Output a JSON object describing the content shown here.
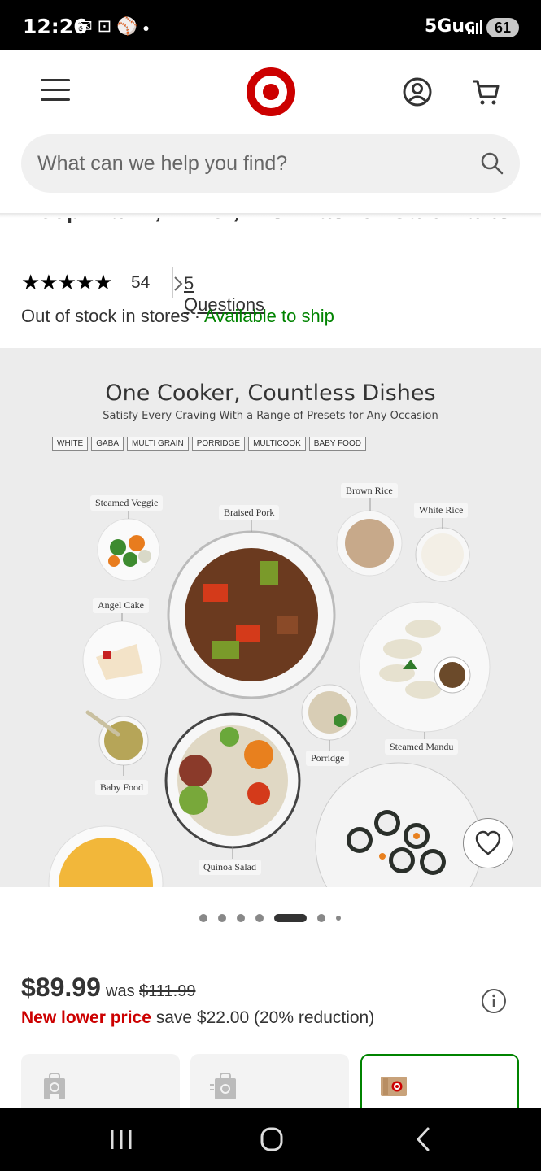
{
  "status_bar": {
    "time": "12:26",
    "notification_icons": [
      "mail-icon",
      "screenshot-icon",
      "sports-ball-icon",
      "dot-icon"
    ],
    "network": "5Guc",
    "battery": "61"
  },
  "header": {
    "brand": "Target",
    "search_placeholder": "What can we help you find?"
  },
  "product": {
    "title": "Keep Warm, Timer, Dishwasher-Safe Parts",
    "rating": "5",
    "review_count": "54",
    "questions": "5 Questions",
    "stock_status": "Out of stock in stores",
    "separator": "·",
    "ship_status": "Available to ship"
  },
  "image": {
    "headline": "One Cooker, Countless Dishes",
    "subheadline": "Satisfy Every Craving With a Range of Presets for Any Occasion",
    "presets": [
      "WHITE",
      "GABA",
      "MULTI GRAIN",
      "PORRIDGE",
      "MULTICOOK",
      "BABY FOOD"
    ],
    "dishes": {
      "steamed_veggie": "Steamed Veggie",
      "braised_pork": "Braised Pork",
      "brown_rice": "Brown Rice",
      "white_rice": "White Rice",
      "angel_cake": "Angel Cake",
      "porridge": "Porridge",
      "steamed_mandu": "Steamed Mandu",
      "baby_food": "Baby Food",
      "quinoa_salad": "Quinoa Salad"
    }
  },
  "carousel": {
    "total_dots": 7,
    "active_index": 4
  },
  "pricing": {
    "price": "$89.99",
    "was_label": "was",
    "was_price": "$111.99",
    "promo": "New lower price",
    "savings": "save $22.00 (20% reduction)"
  },
  "colors": {
    "brand_red": "#cc0000",
    "ship_green": "#008300"
  }
}
